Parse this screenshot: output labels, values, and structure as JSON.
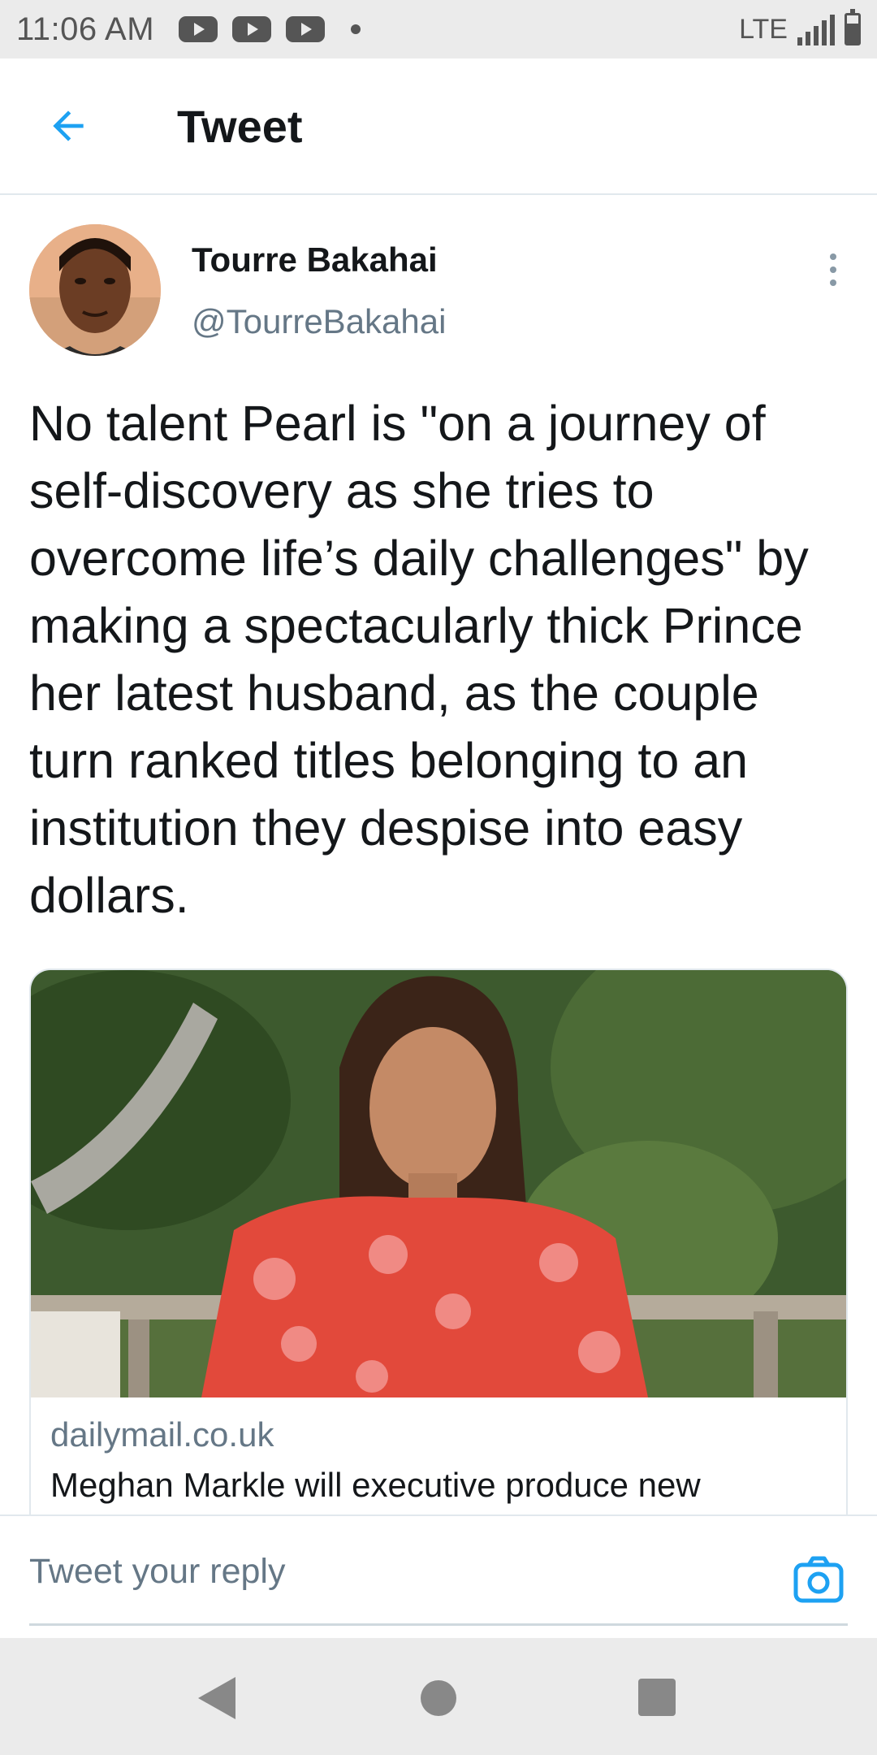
{
  "status_bar": {
    "time": "11:06 AM",
    "network": "LTE",
    "notification_icons": [
      "youtube-icon",
      "youtube-icon",
      "youtube-icon",
      "dot-icon"
    ]
  },
  "header": {
    "back_icon": "arrow-left-icon",
    "title": "Tweet"
  },
  "tweet": {
    "author_name": "Tourre Bakahai",
    "author_handle": "@TourreBakahai",
    "text": "No talent Pearl is \"on a journey of self-discovery as she tries to overcome life’s daily challenges\" by making a spectacularly thick Prince her latest husband, as the couple turn ranked titles belonging to an institution they despise into easy dollars.",
    "card": {
      "domain": "dailymail.co.uk",
      "title": "Meghan Markle will executive produce new"
    }
  },
  "reply": {
    "placeholder": "Tweet your reply",
    "camera_icon": "camera-icon"
  },
  "nav_bar": {
    "icons": [
      "nav-back-icon",
      "nav-home-icon",
      "nav-recents-icon"
    ]
  },
  "colors": {
    "accent": "#1da1f2",
    "text_primary": "#14171a",
    "text_secondary": "#657786",
    "status_bar_bg": "#ebebeb"
  }
}
